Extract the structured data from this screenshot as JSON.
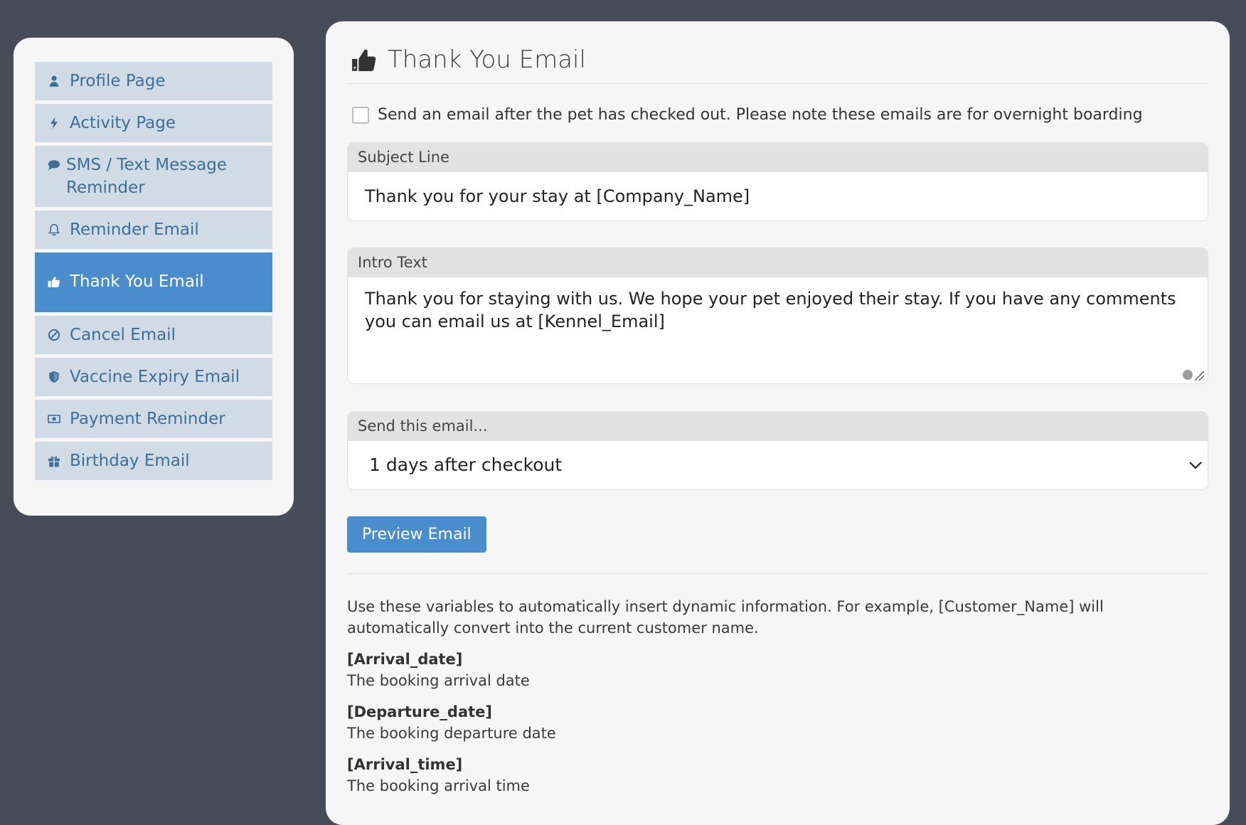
{
  "colors": {
    "background": "#464d59",
    "panel": "#f6f6f6",
    "nav_item": "#d0dbe6",
    "nav_text": "#3d6f98",
    "accent": "#4a8dcc"
  },
  "sidebar": {
    "items": [
      {
        "label": "Profile Page",
        "icon": "user-icon",
        "active": false
      },
      {
        "label": "Activity Page",
        "icon": "bolt-icon",
        "active": false
      },
      {
        "label": "SMS / Text Message Reminder",
        "icon": "comment-icon",
        "active": false
      },
      {
        "label": "Reminder Email",
        "icon": "bell-icon",
        "active": false
      },
      {
        "label": "Thank You Email",
        "icon": "thumbs-up-icon",
        "active": true
      },
      {
        "label": "Cancel Email",
        "icon": "ban-icon",
        "active": false
      },
      {
        "label": "Vaccine Expiry Email",
        "icon": "shield-icon",
        "active": false
      },
      {
        "label": "Payment Reminder",
        "icon": "money-bill-icon",
        "active": false
      },
      {
        "label": "Birthday Email",
        "icon": "gift-icon",
        "active": false
      }
    ]
  },
  "main": {
    "title": "Thank You Email",
    "title_icon": "thumbs-up-icon",
    "checkbox": {
      "checked": false,
      "label": "Send an email after the pet has checked out. Please note these emails are for overnight boarding"
    },
    "subject": {
      "label": "Subject Line",
      "value": "Thank you for your stay at [Company_Name]"
    },
    "intro": {
      "label": "Intro Text",
      "value": "Thank you for staying with us. We hope your pet enjoyed their stay. If you have any comments you can email us at [Kennel_Email]"
    },
    "send": {
      "label": "Send this email...",
      "selected": "1 days after checkout"
    },
    "preview_button": "Preview Email",
    "help_text": "Use these variables to automatically insert dynamic information. For example, [Customer_Name] will automatically convert into the current customer name.",
    "variables": [
      {
        "name": "[Arrival_date]",
        "description": "The booking arrival date"
      },
      {
        "name": "[Departure_date]",
        "description": "The booking departure date"
      },
      {
        "name": "[Arrival_time]",
        "description": "The booking arrival time"
      }
    ]
  }
}
